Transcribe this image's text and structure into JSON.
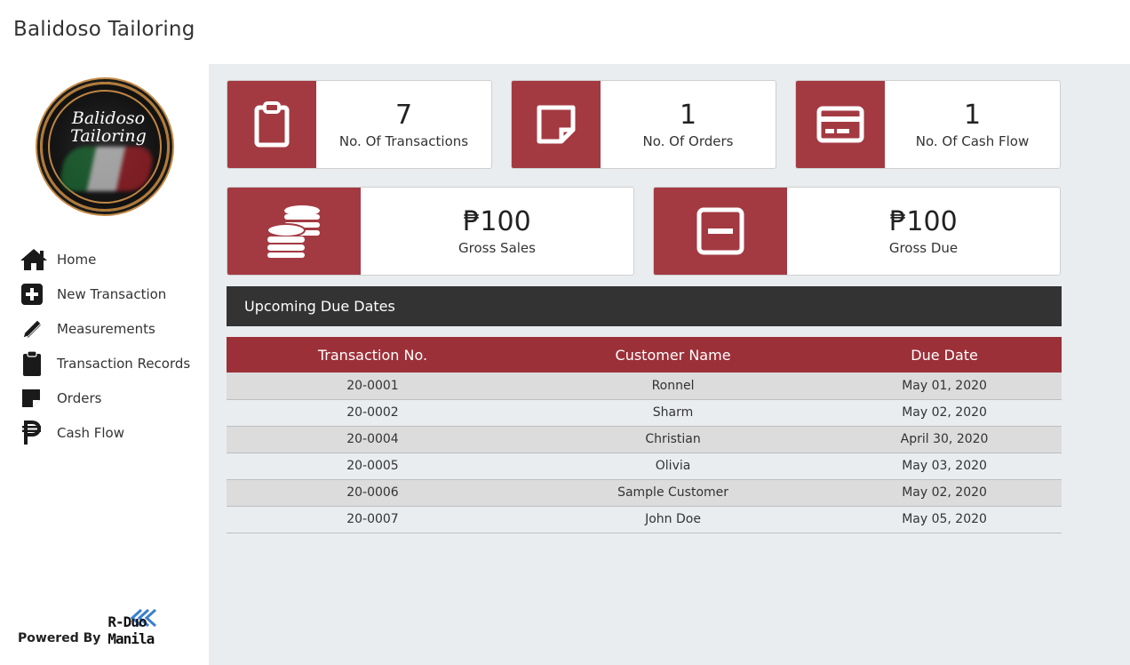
{
  "app": {
    "title": "Balidoso Tailoring"
  },
  "logo": {
    "line1": "Balidoso",
    "line2": "Tailoring"
  },
  "sidebar": {
    "items": [
      {
        "label": "Home",
        "icon": "home-icon"
      },
      {
        "label": "New Transaction",
        "icon": "plus-square-icon"
      },
      {
        "label": "Measurements",
        "icon": "ruler-pencil-icon"
      },
      {
        "label": "Transaction Records",
        "icon": "clipboard-icon"
      },
      {
        "label": "Orders",
        "icon": "sticky-note-icon"
      },
      {
        "label": "Cash Flow",
        "icon": "peso-icon"
      }
    ]
  },
  "footer": {
    "powered_by": "Powered By",
    "brand": "R-Duo Manila"
  },
  "stats": [
    {
      "value": "7",
      "label": "No. Of Transactions",
      "icon": "clipboard-icon"
    },
    {
      "value": "1",
      "label": "No. Of Orders",
      "icon": "sticky-note-icon"
    },
    {
      "value": "1",
      "label": "No. Of Cash Flow",
      "icon": "credit-card-icon"
    },
    {
      "value": "₱100",
      "label": "Gross Sales",
      "icon": "coins-icon"
    },
    {
      "value": "₱100",
      "label": "Gross Due",
      "icon": "minus-square-icon"
    }
  ],
  "due_dates": {
    "title": "Upcoming Due Dates",
    "columns": [
      "Transaction No.",
      "Customer Name",
      "Due Date"
    ],
    "rows": [
      [
        "20-0001",
        "Ronnel",
        "May 01, 2020"
      ],
      [
        "20-0002",
        "Sharm",
        "May 02, 2020"
      ],
      [
        "20-0004",
        "Christian",
        "April 30, 2020"
      ],
      [
        "20-0005",
        "Olivia",
        "May 03, 2020"
      ],
      [
        "20-0006",
        "Sample Customer",
        "May 02, 2020"
      ],
      [
        "20-0007",
        "John Doe",
        "May 05, 2020"
      ]
    ]
  },
  "colors": {
    "accent": "#a33a42",
    "table_header": "#9c3039",
    "section_header": "#333333",
    "main_bg": "#e9edf0"
  }
}
